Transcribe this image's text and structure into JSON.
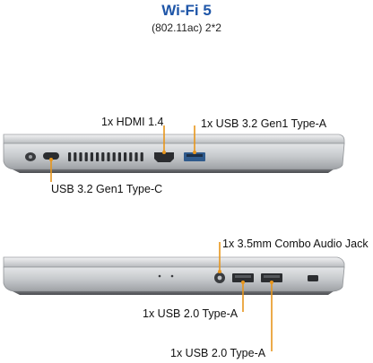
{
  "header": {
    "title": "Wi-Fi 5",
    "subtitle": "(802.11ac) 2*2"
  },
  "left_side": {
    "ports": [
      {
        "id": "hdmi",
        "label": "1x HDMI 1.4"
      },
      {
        "id": "usb-a-gen1",
        "label": "1x USB 3.2 Gen1 Type-A"
      },
      {
        "id": "usb-c-gen1",
        "label": "USB 3.2 Gen1 Type-C"
      }
    ]
  },
  "right_side": {
    "ports": [
      {
        "id": "audio-jack",
        "label": "1x 3.5mm Combo Audio Jack"
      },
      {
        "id": "usb2-a-1",
        "label": "1x USB 2.0 Type-A"
      },
      {
        "id": "usb2-a-2",
        "label": "1x USB 2.0 Type-A"
      }
    ]
  },
  "colors": {
    "title": "#1f56a8",
    "callout_line": "#e8961c",
    "laptop_body": "#c9cccf",
    "laptop_edge": "#8f9296",
    "port_dark": "#2b2d30",
    "usb_blue": "#2f5a8c"
  }
}
